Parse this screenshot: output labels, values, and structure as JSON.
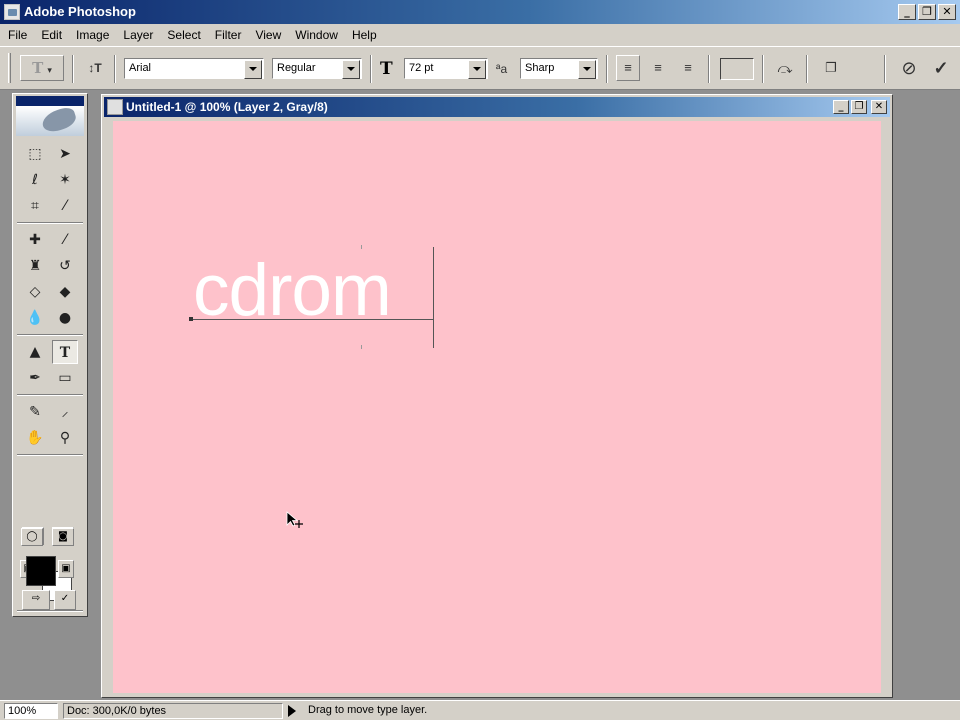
{
  "app": {
    "title": "Adobe Photoshop"
  },
  "window_controls": {
    "minimize": "_",
    "restore": "❐",
    "close": "✕"
  },
  "menu": [
    "File",
    "Edit",
    "Image",
    "Layer",
    "Select",
    "Filter",
    "View",
    "Window",
    "Help"
  ],
  "options": {
    "font_family": "Arial",
    "font_style": "Regular",
    "font_size": "72 pt",
    "antialias": "Sharp",
    "tool_preset_icon": "type-tool-icon",
    "cancel_icon": "cancel-icon",
    "commit_icon": "checkmark-icon"
  },
  "toolbox": {
    "tools": [
      "marquee-tool-icon",
      "move-tool-icon",
      "lasso-tool-icon",
      "magic-wand-tool-icon",
      "crop-tool-icon",
      "slice-tool-icon",
      "healing-brush-icon",
      "brush-tool-icon",
      "clone-stamp-icon",
      "history-brush-icon",
      "eraser-tool-icon",
      "paint-bucket-icon",
      "blur-tool-icon",
      "dodge-tool-icon",
      "path-select-icon",
      "type-tool-icon",
      "pen-tool-icon",
      "rectangle-tool-icon",
      "notes-tool-icon",
      "eyedropper-icon",
      "hand-tool-icon",
      "zoom-tool-icon"
    ],
    "selected_tool": "type-tool-icon",
    "foreground_color": "#000000",
    "background_color": "#ffffff"
  },
  "document": {
    "title": "Untitled-1 @ 100% (Layer 2, Gray/8)",
    "canvas_color": "#fec2cb",
    "text": "cdrom",
    "text_color": "#ffffff"
  },
  "status": {
    "zoom": "100%",
    "doc_size": "Doc: 300,0K/0 bytes",
    "message": "Drag to move type layer."
  }
}
